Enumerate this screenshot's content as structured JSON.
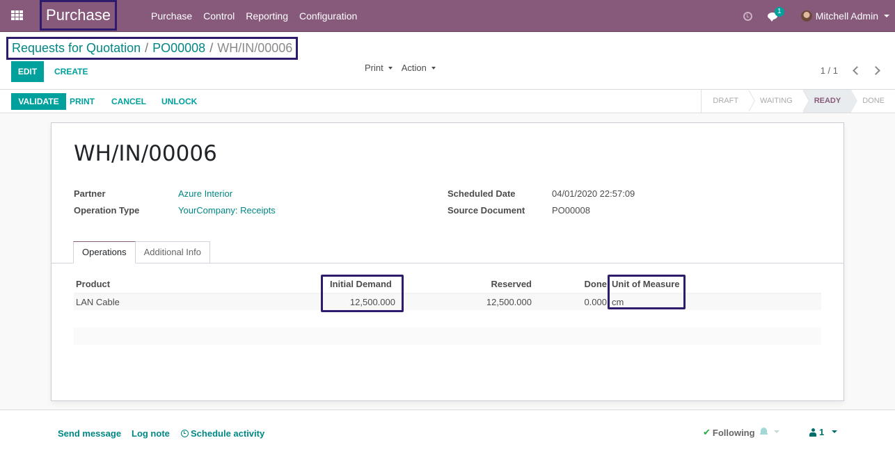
{
  "navbar": {
    "app_name": "Purchase",
    "menu": [
      "Purchase",
      "Control",
      "Reporting",
      "Configuration"
    ],
    "messages_count": "1",
    "user_name": "Mitchell Admin"
  },
  "breadcrumb": {
    "items": [
      "Requests for Quotation",
      "PO00008"
    ],
    "current": "WH/IN/00006",
    "separator": "/"
  },
  "control_panel": {
    "edit_label": "Edit",
    "create_label": "Create",
    "print_label": "Print",
    "action_label": "Action",
    "pager_value": "1 / 1"
  },
  "statusbar": {
    "buttons": {
      "validate": "Validate",
      "print": "Print",
      "cancel": "Cancel",
      "unlock": "Unlock"
    },
    "stages": [
      "Draft",
      "Waiting",
      "Ready",
      "Done"
    ],
    "current_stage": "Ready"
  },
  "record": {
    "title": "WH/IN/00006",
    "fields": {
      "partner_label": "Partner",
      "partner_value": "Azure Interior",
      "operation_type_label": "Operation Type",
      "operation_type_value": "YourCompany: Receipts",
      "scheduled_date_label": "Scheduled Date",
      "scheduled_date_value": "04/01/2020 22:57:09",
      "source_document_label": "Source Document",
      "source_document_value": "PO00008"
    },
    "tabs": [
      "Operations",
      "Additional Info"
    ],
    "active_tab": "Operations",
    "operations_table": {
      "columns": [
        "Product",
        "Initial Demand",
        "Reserved",
        "Done",
        "Unit of Measure"
      ],
      "rows": [
        {
          "product": "LAN Cable",
          "initial_demand": "12,500.000",
          "reserved": "12,500.000",
          "done": "0.000",
          "uom": "cm"
        }
      ]
    }
  },
  "chatter": {
    "send_message": "Send message",
    "log_note": "Log note",
    "schedule_activity": "Schedule activity",
    "following": "Following",
    "followers_count": "1"
  },
  "colors": {
    "brand": "#875a7b",
    "accent": "#00a09d",
    "highlight_box": "#2e1b6b"
  }
}
